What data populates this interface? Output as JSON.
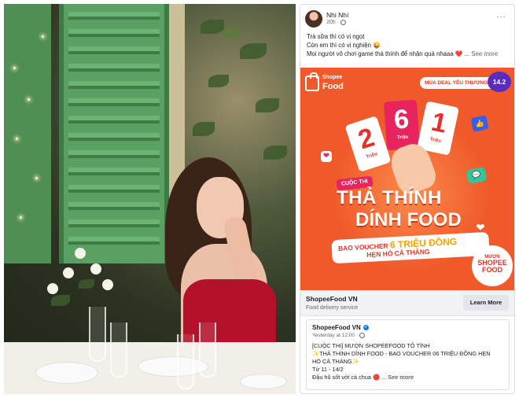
{
  "post": {
    "author": "Nhi Nhí",
    "time": "20h",
    "more_icon": "···",
    "lines": [
      "Trà sữa thì có vị ngọt",
      "Còn em thì có vị nghiện 😜",
      "Mọi người vô chơi game thả thính để nhận quà nhaaa ❤️ ..."
    ],
    "see_more": "See more"
  },
  "promo": {
    "logo_line1": "Shopee",
    "logo_line2": "Food",
    "season": "MÙA DEAL YÊU THƯƠNG",
    "date": "14.2",
    "tickets": [
      {
        "num": "2",
        "unit": "Triệu"
      },
      {
        "num": "6",
        "unit": "Triệu"
      },
      {
        "num": "1",
        "unit": "Triệu"
      }
    ],
    "contest_tag": "CUỘC THI",
    "title1": "THẢ THÍNH",
    "title2": "DÍNH FOOD",
    "voucher_prefix": "BAO VOUCHER",
    "voucher_big": "6 TRIỆU ĐỒNG",
    "voucher_line2": "HẸN HÒ CẢ THÁNG",
    "stamp_1": "MƯỢN",
    "stamp_2": "SHOPEE",
    "stamp_3": "FOOD"
  },
  "link": {
    "title": "ShopeeFood VN",
    "subtitle": "Food delivery service",
    "button": "Learn More"
  },
  "embed": {
    "author": "ShopeeFood VN",
    "time": "Yesterday at 12:00",
    "lines": [
      "[CUỘC THI] MƯỢN SHOPEEFOOD TỎ TÌNH",
      "✨THẢ THÍNH DÍNH FOOD - BAO VOUCHER 06 TRIỆU ĐỒNG HẸN",
      "HÒ CẢ THÁNG✨",
      "Từ 11 - 14/2",
      "Đậu hũ sốt với cà chua 🔴 ..."
    ],
    "see_more": "See more"
  },
  "icons": {
    "like": "👍",
    "chat": "💬",
    "heart": "❤"
  }
}
